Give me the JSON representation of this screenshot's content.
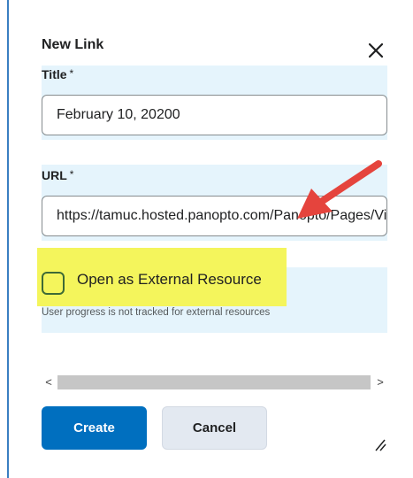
{
  "dialog": {
    "title": "New Link"
  },
  "title_field": {
    "label": "Title",
    "required_marker": "*",
    "value": "February 10, 20200"
  },
  "url_field": {
    "label": "URL",
    "required_marker": "*",
    "value": "https://tamuc.hosted.panopto.com/Panopto/Pages/Viewer.aspx"
  },
  "external_resource": {
    "label": "Open as External Resource",
    "checked": false,
    "help_text": "User progress is not tracked for external resources"
  },
  "scrollbar": {
    "left_arrow": "<",
    "right_arrow": ">"
  },
  "buttons": {
    "create_label": "Create",
    "cancel_label": "Cancel"
  },
  "icons": {
    "close": "close-icon",
    "resize": "resize-grip-icon"
  },
  "colors": {
    "primary_button": "#006fbf",
    "highlight": "#f4f55c",
    "field_band": "#e5f4fc",
    "annotation_arrow": "#e5443d",
    "checkbox_border": "#3d6a36"
  }
}
